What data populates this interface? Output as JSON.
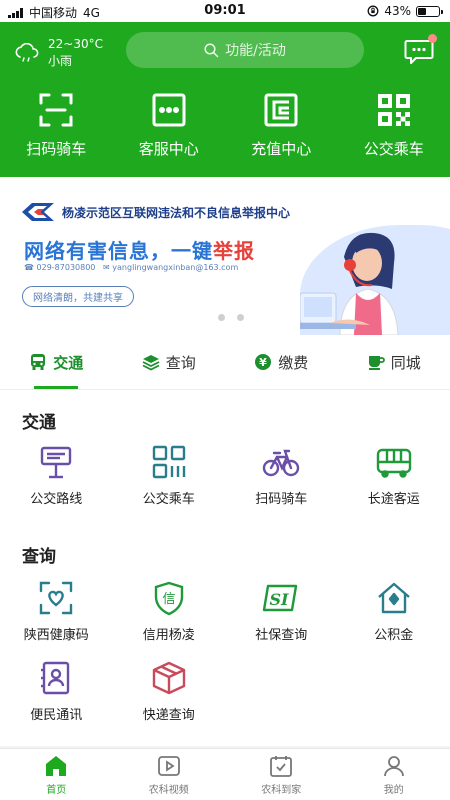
{
  "status": {
    "carrier": "中国移动",
    "network": "4G",
    "time": "09:01",
    "battery": "43%"
  },
  "header": {
    "weather": {
      "temp": "22~30°C",
      "desc": "小雨"
    },
    "search_placeholder": "功能/活动",
    "quick_actions": [
      {
        "label": "扫码骑车",
        "icon": "scan-icon"
      },
      {
        "label": "客服中心",
        "icon": "customer-service-icon"
      },
      {
        "label": "充值中心",
        "icon": "wallet-icon"
      },
      {
        "label": "公交乘车",
        "icon": "qr-code-icon"
      }
    ],
    "accent": "#1fa91f"
  },
  "banner": {
    "org": "杨凌示范区互联网违法和不良信息举报中心",
    "slogan_main": "网络有害信息，一键",
    "slogan_emph": "举报",
    "phone": "029-87030800",
    "email": "yanglingwangxinban@163.com",
    "pill": "网络清朗，共建共享"
  },
  "tabs": [
    {
      "label": "交通",
      "icon": "bus-icon",
      "active": true
    },
    {
      "label": "查询",
      "icon": "stack-icon",
      "active": false
    },
    {
      "label": "缴费",
      "icon": "yen-icon",
      "active": false
    },
    {
      "label": "同城",
      "icon": "cup-icon",
      "active": false
    }
  ],
  "sections": {
    "traffic": {
      "title": "交通",
      "items": [
        {
          "label": "公交路线",
          "icon": "bus-stop-icon"
        },
        {
          "label": "公交乘车",
          "icon": "qr-code-icon"
        },
        {
          "label": "扫码骑车",
          "icon": "bicycle-icon"
        },
        {
          "label": "长途客运",
          "icon": "coach-icon"
        }
      ]
    },
    "query": {
      "title": "查询",
      "items": [
        {
          "label": "陕西健康码",
          "icon": "health-code-icon"
        },
        {
          "label": "信用杨凌",
          "icon": "credit-shield-icon"
        },
        {
          "label": "社保查询",
          "icon": "social-security-icon"
        },
        {
          "label": "公积金",
          "icon": "house-icon"
        },
        {
          "label": "便民通讯",
          "icon": "contacts-icon"
        },
        {
          "label": "快递查询",
          "icon": "parcel-icon"
        }
      ]
    }
  },
  "bottom_nav": [
    {
      "label": "首页",
      "icon": "home-icon",
      "active": true
    },
    {
      "label": "农科视频",
      "icon": "video-icon",
      "active": false
    },
    {
      "label": "农科到家",
      "icon": "calendar-check-icon",
      "active": false
    },
    {
      "label": "我的",
      "icon": "user-icon",
      "active": false
    }
  ]
}
